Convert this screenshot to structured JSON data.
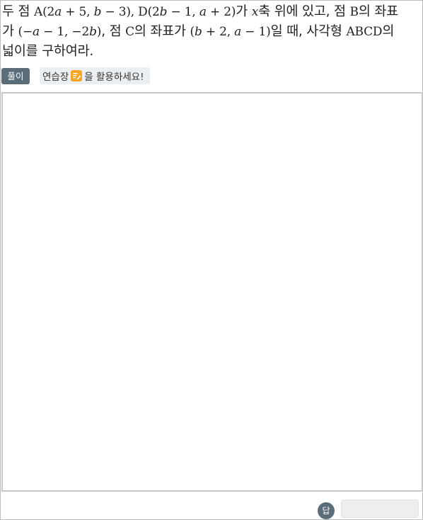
{
  "question": {
    "line1": {
      "t1": "두 점 ",
      "p1": "A(2",
      "v1": "a",
      "p2": " + 5, ",
      "v2": "b",
      "p3": " − 3), D(2",
      "v3": "b",
      "p4": " − 1, ",
      "v4": "a",
      "p5": " + 2)",
      "t2": "가 ",
      "v5": "x",
      "t3": "축 위에 있고, 점 ",
      "p6": "B",
      "t4": "의 좌표"
    },
    "line2": {
      "t1": "가 ",
      "p1": "(−",
      "v1": "a",
      "p2": " − 1, −2",
      "v2": "b",
      "p3": ")",
      "t2": ", 점 ",
      "p4": "C",
      "t3": "의 좌표가 ",
      "p5": "(",
      "v3": "b",
      "p6": " + 2, ",
      "v4": "a",
      "p7": " − 1)",
      "t4": "일 때, 사각형 ",
      "p8": "ABCD",
      "t5": "의"
    },
    "line3": "넓이를 구하여라."
  },
  "toolbar": {
    "solution_label": "풀이",
    "practice_prefix": "연습장",
    "practice_icon": "pencil-icon",
    "practice_suffix": "을 활용하세요!"
  },
  "answer": {
    "label": "답",
    "value": ""
  },
  "colors": {
    "button_bg": "#5b6d78",
    "icon_accent": "#f5a623",
    "tip_bg": "#eceff1"
  }
}
